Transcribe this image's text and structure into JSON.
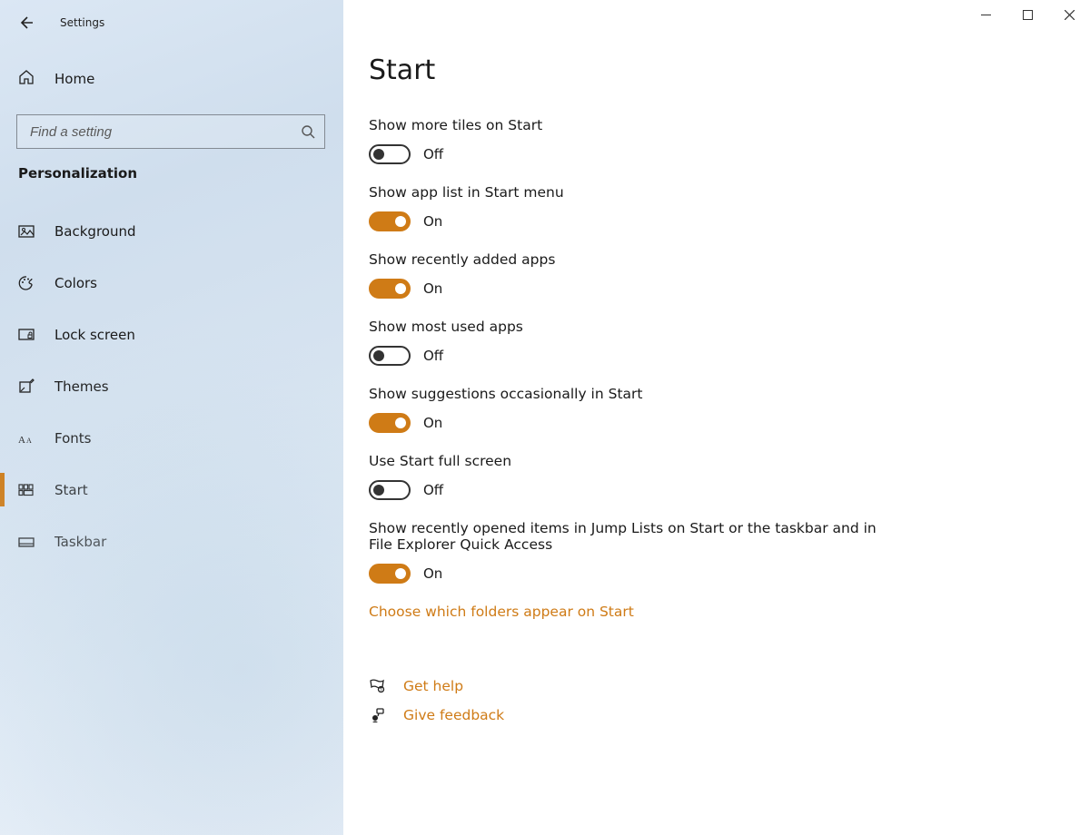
{
  "app_title": "Settings",
  "home_label": "Home",
  "search": {
    "placeholder": "Find a setting"
  },
  "section_header": "Personalization",
  "sidebar": {
    "items": [
      {
        "id": "background",
        "label": "Background",
        "icon": "picture-icon",
        "selected": false
      },
      {
        "id": "colors",
        "label": "Colors",
        "icon": "palette-icon",
        "selected": false
      },
      {
        "id": "lock-screen",
        "label": "Lock screen",
        "icon": "lockscreen-icon",
        "selected": false
      },
      {
        "id": "themes",
        "label": "Themes",
        "icon": "themes-icon",
        "selected": false
      },
      {
        "id": "fonts",
        "label": "Fonts",
        "icon": "fonts-icon",
        "selected": false
      },
      {
        "id": "start",
        "label": "Start",
        "icon": "start-icon",
        "selected": true
      },
      {
        "id": "taskbar",
        "label": "Taskbar",
        "icon": "taskbar-icon",
        "selected": false
      }
    ]
  },
  "page": {
    "title": "Start"
  },
  "toggle_labels": {
    "on": "On",
    "off": "Off"
  },
  "settings": [
    {
      "id": "more-tiles",
      "label": "Show more tiles on Start",
      "value": false
    },
    {
      "id": "app-list",
      "label": "Show app list in Start menu",
      "value": true
    },
    {
      "id": "recently-added",
      "label": "Show recently added apps",
      "value": true
    },
    {
      "id": "most-used",
      "label": "Show most used apps",
      "value": false
    },
    {
      "id": "suggestions",
      "label": "Show suggestions occasionally in Start",
      "value": true
    },
    {
      "id": "full-screen",
      "label": "Use Start full screen",
      "value": false
    },
    {
      "id": "jump-lists",
      "label": "Show recently opened items in Jump Lists on Start or the taskbar and in File Explorer Quick Access",
      "value": true
    }
  ],
  "link": "Choose which folders appear on Start",
  "help": {
    "get_help": "Get help",
    "give_feedback": "Give feedback"
  },
  "accent_color": "#cf7b16"
}
